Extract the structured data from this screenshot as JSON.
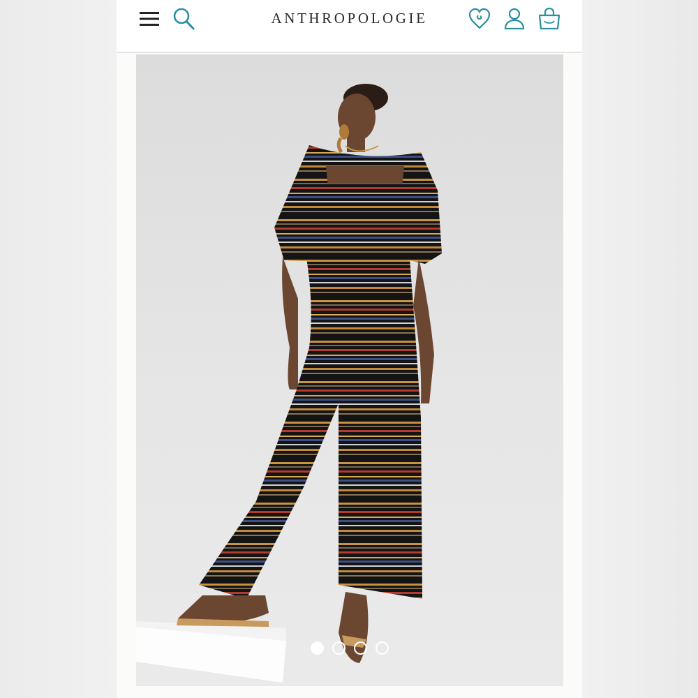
{
  "header": {
    "brand": "ANTHROPOLOGIE",
    "icons": {
      "menu": "hamburger-menu-icon",
      "search": "search-icon",
      "wishlist": "heart-icon",
      "account": "user-icon",
      "bag": "shopping-bag-icon"
    }
  },
  "product_image": {
    "carousel": {
      "dots": 4,
      "active_index": 0
    }
  },
  "colors": {
    "accent": "#2a8fa0",
    "icon_dark": "#222222",
    "header_bg": "#ffffff",
    "page_bg": "#ececec"
  }
}
